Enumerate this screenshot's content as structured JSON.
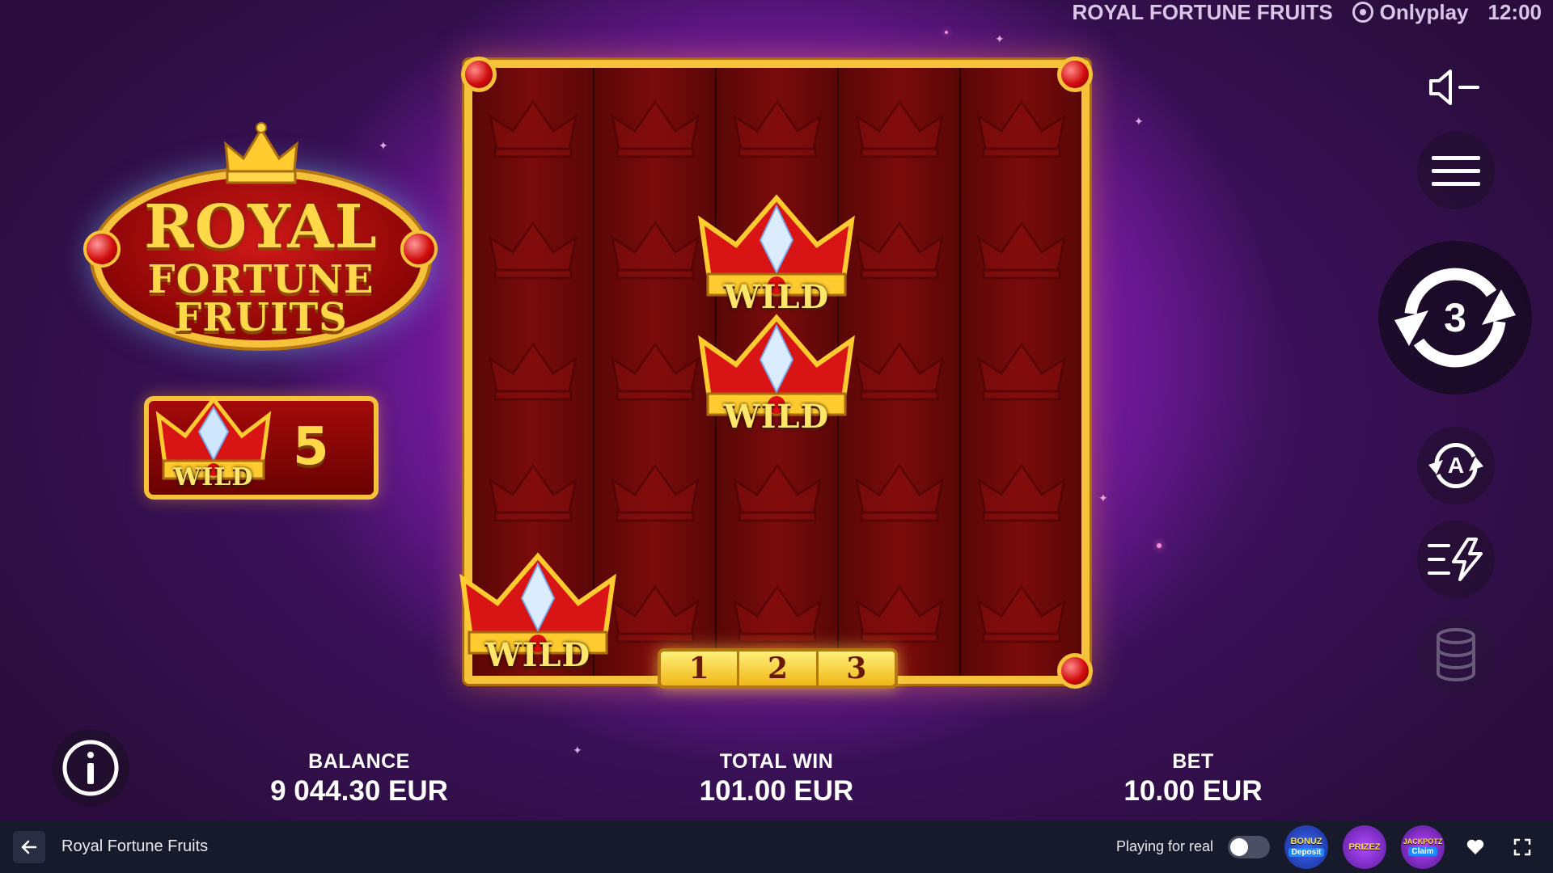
{
  "header": {
    "game_title": "ROYAL FORTUNE FRUITS",
    "provider": "Onlyplay",
    "clock": "12:00"
  },
  "logo": {
    "line1": "ROYAL",
    "line2": "FORTUNE",
    "line3": "FRUITS"
  },
  "wild_counter": {
    "symbol_label": "WILD",
    "count": "5"
  },
  "reels": {
    "wild_label": "WILD",
    "lines": [
      "1",
      "2",
      "3"
    ]
  },
  "controls": {
    "respin_count": "3",
    "autoplay_letter": "A"
  },
  "stats": {
    "balance_label": "BALANCE",
    "balance_value": "9 044.30 EUR",
    "total_win_label": "TOTAL WIN",
    "total_win_value": "101.00 EUR",
    "bet_label": "BET",
    "bet_value": "10.00 EUR"
  },
  "footer": {
    "title": "Royal Fortune Fruits",
    "play_mode": "Playing for real",
    "promos": [
      {
        "name": "BONUZ",
        "sub": "Deposit"
      },
      {
        "name": "PRIZEZ",
        "sub": ""
      },
      {
        "name": "JACKPOTZ",
        "sub": "Claim"
      }
    ]
  },
  "colors": {
    "gold": "#f5c23a",
    "reel_red": "#7a0b0b",
    "magenta_glow": "#f04cf5",
    "footer_bg": "#171a2a"
  }
}
